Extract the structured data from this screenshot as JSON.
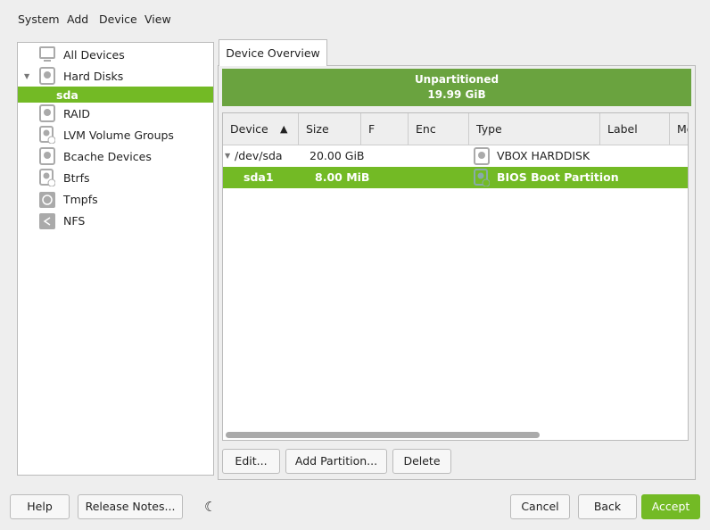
{
  "menu": [
    "System",
    "Add",
    "Device",
    "View"
  ],
  "tree": [
    {
      "label": "All Devices",
      "icon": "monitor-icon"
    },
    {
      "label": "Hard Disks",
      "icon": "harddisk-icon"
    },
    {
      "label": "sda",
      "icon": ""
    },
    {
      "label": "RAID",
      "icon": "raid-icon"
    },
    {
      "label": "LVM Volume Groups",
      "icon": "lvm-icon"
    },
    {
      "label": "Bcache Devices",
      "icon": "bcache-icon"
    },
    {
      "label": "Btrfs",
      "icon": "btrfs-icon"
    },
    {
      "label": "Tmpfs",
      "icon": "tmpfs-icon"
    },
    {
      "label": "NFS",
      "icon": "nfs-icon"
    }
  ],
  "tab": "Device Overview",
  "bar": {
    "title": "Unpartitioned",
    "size": "19.99 GiB"
  },
  "columns": [
    "Device",
    "Size",
    "F",
    "Enc",
    "Type",
    "Label",
    "Mo"
  ],
  "rows": [
    {
      "device": "/dev/sda",
      "size": "20.00 GiB",
      "type": "VBOX HARDDISK"
    },
    {
      "device": "sda1",
      "size": "8.00 MiB",
      "type": "BIOS Boot Partition"
    }
  ],
  "actions": {
    "edit": "Edit...",
    "add_partition": "Add Partition...",
    "delete": "Delete"
  },
  "footer": {
    "help": "Help",
    "release_notes": "Release Notes...",
    "cancel": "Cancel",
    "back": "Back",
    "accept": "Accept"
  },
  "colors": {
    "accent": "#73ba25",
    "bar": "#6aa33f"
  }
}
